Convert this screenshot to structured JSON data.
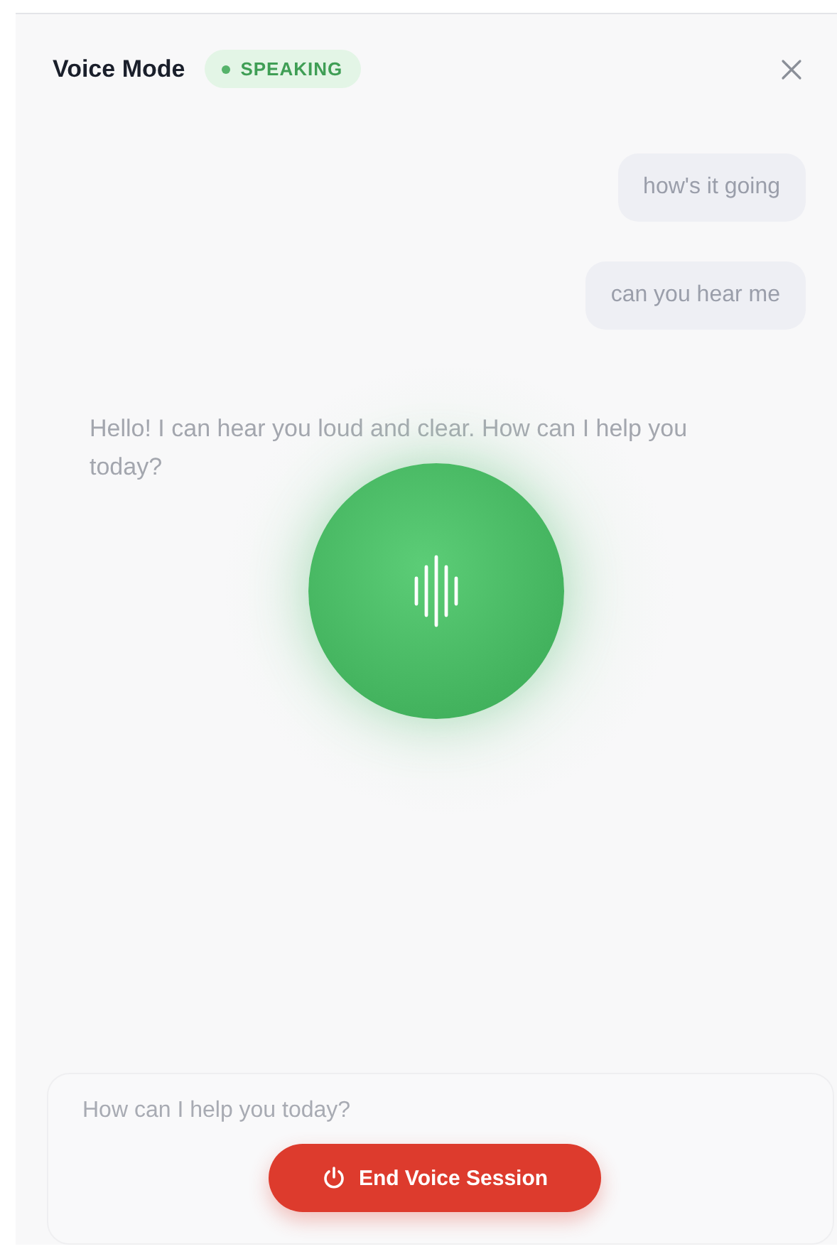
{
  "header": {
    "title": "Voice Mode",
    "status": {
      "label": "SPEAKING",
      "kind": "speaking"
    }
  },
  "messages": [
    {
      "kind": "user",
      "text": "how's it going"
    },
    {
      "kind": "user",
      "text": "can you hear me"
    },
    {
      "kind": "assistant",
      "text": "Hello! I can hear you loud and clear. How can I help you today?"
    }
  ],
  "composer": {
    "placeholder": "How can I help you today?"
  },
  "end_button": {
    "label": "End Voice Session"
  }
}
